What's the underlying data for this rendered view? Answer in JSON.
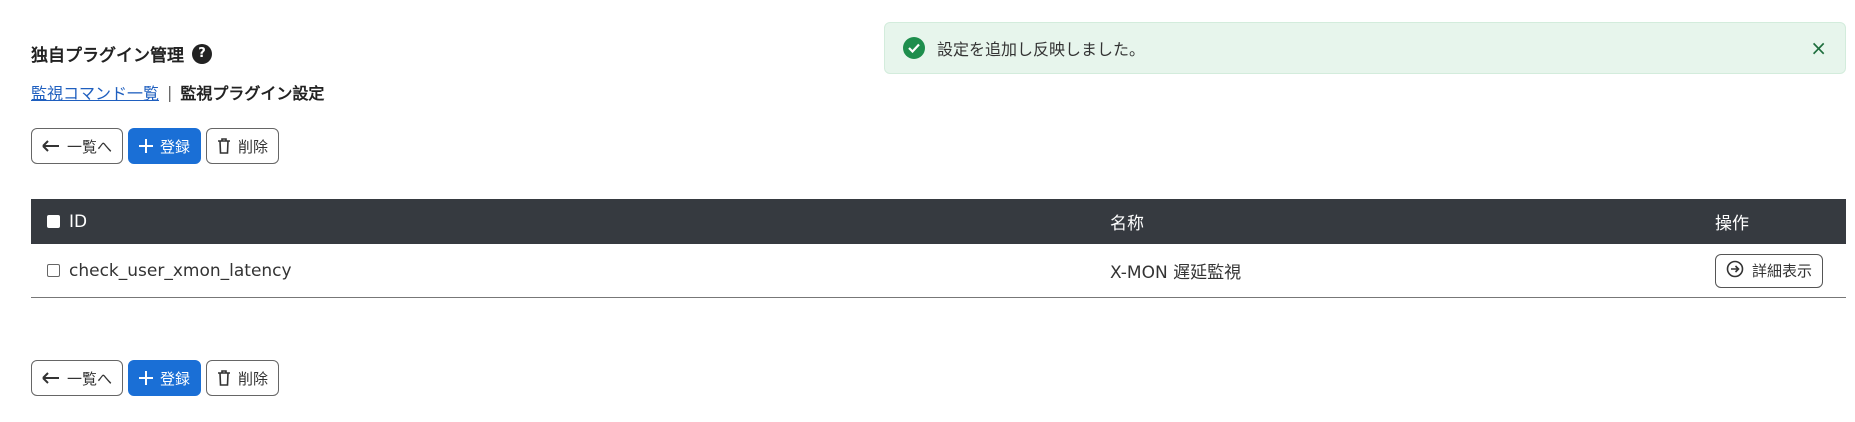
{
  "page": {
    "title": "独自プラグイン管理",
    "help_icon": "?"
  },
  "breadcrumb": {
    "link_label": "監視コマンド一覧",
    "separator": "|",
    "current_label": "監視プラグイン設定"
  },
  "toolbar": {
    "back_label": "一覧へ",
    "register_label": "登録",
    "delete_label": "削除"
  },
  "toast": {
    "message": "設定を追加し反映しました。",
    "close_icon": "×",
    "color": "#e7f5ec",
    "icon_color": "#1e8e4d"
  },
  "table": {
    "columns": [
      "ID",
      "名称",
      "操作"
    ],
    "rows": [
      {
        "id": "check_user_xmon_latency",
        "name": "X-MON 遅延監視",
        "action_label": "詳細表示"
      }
    ],
    "header_color": "#363a40"
  },
  "colors": {
    "primary": "#1a6fd6",
    "link": "#1f5fbf"
  },
  "icons": {
    "back": "arrow-left-icon",
    "register": "plus-icon",
    "delete": "trash-icon",
    "detail": "arrow-circle-right-icon",
    "success": "check-circle-icon",
    "help": "question-circle-icon"
  }
}
